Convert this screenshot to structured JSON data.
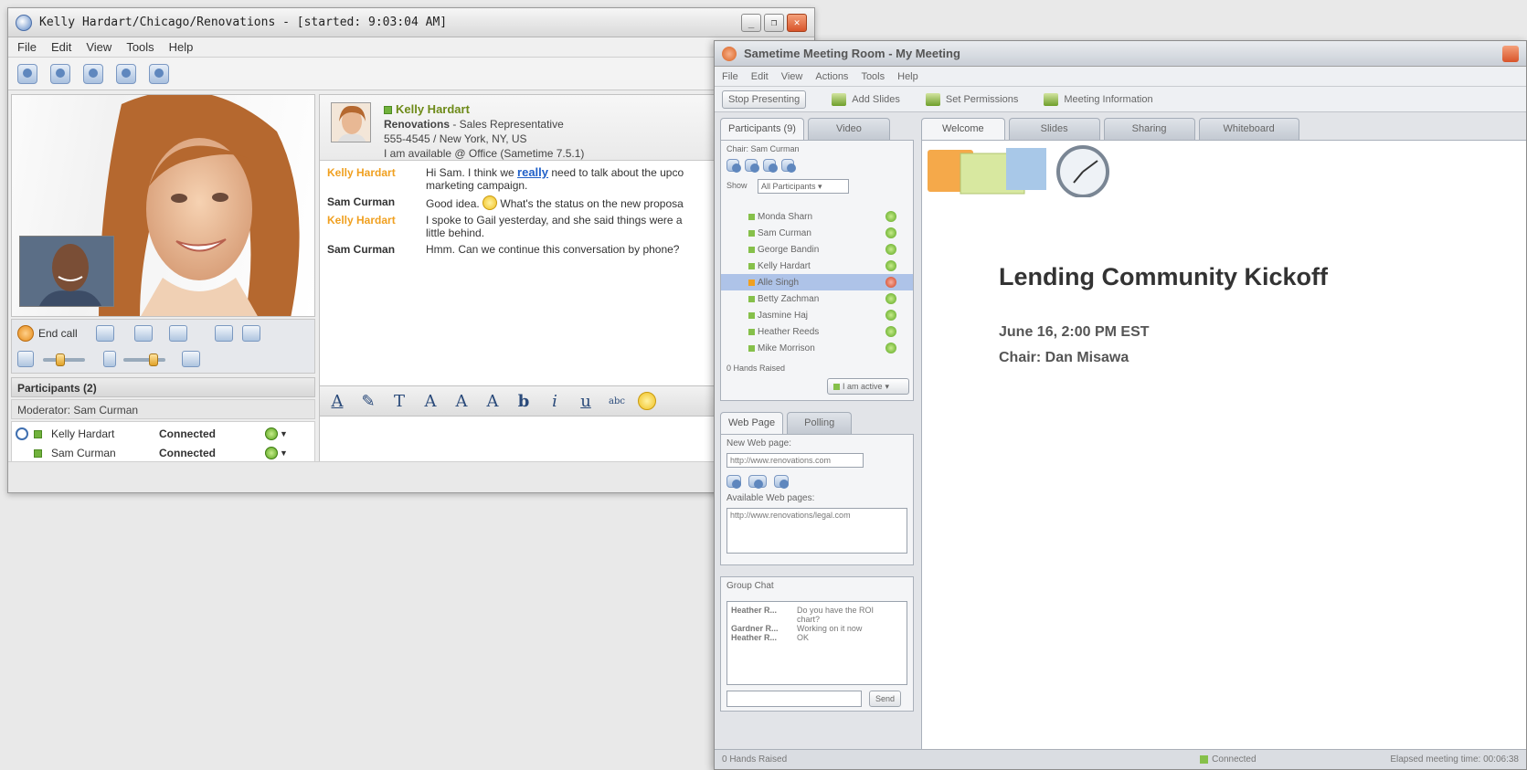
{
  "chat_window": {
    "title": "Kelly Hardart/Chicago/Renovations - [started: 9:03:04 AM]",
    "menu": [
      "File",
      "Edit",
      "View",
      "Tools",
      "Help"
    ],
    "end_call_label": "End call",
    "participants_header": "Participants (2)",
    "moderator": "Moderator: Sam Curman",
    "participants": [
      {
        "name": "Kelly Hardart",
        "status": "Connected"
      },
      {
        "name": "Sam Curman",
        "status": "Connected"
      }
    ],
    "contact": {
      "name": "Kelly Hardart",
      "company": "Renovations",
      "role": " - Sales Representative",
      "phone_location": "555-4545 / New York, NY, US",
      "availability": "I am available @ Office (Sametime 7.5.1)"
    },
    "messages": [
      {
        "sender": "Kelly Hardart",
        "pre": "Hi Sam. I think we ",
        "link": "really",
        "post": " need to talk about the upco marketing campaign."
      },
      {
        "sender": "Sam Curman",
        "pre": "Good idea. ",
        "post": " What's the status on the new proposa"
      },
      {
        "sender": "Kelly Hardart",
        "text": "I spoke to Gail yesterday, and she said things were a little behind."
      },
      {
        "sender": "Sam Curman",
        "text": "Hmm. Can we continue this conversation by phone?"
      }
    ],
    "format_glyphs": [
      "A",
      "✎",
      "T",
      "A",
      "A",
      "A",
      "b",
      "i",
      "u",
      "abc"
    ]
  },
  "meeting_window": {
    "title": "Sametime Meeting Room - My Meeting",
    "menu": [
      "File",
      "Edit",
      "View",
      "Actions",
      "Tools",
      "Help"
    ],
    "toolbar": {
      "stop_presenting": "Stop Presenting",
      "add_slides": "Add Slides",
      "set_permissions": "Set Permissions",
      "meeting_info": "Meeting Information"
    },
    "left_tabs": [
      "Participants (9)",
      "Video"
    ],
    "chair": "Chair: Sam Curman",
    "show_label": "Show",
    "show_select": "All Participants",
    "participants": [
      {
        "name": "Monda Sharn",
        "selected": false,
        "status": "green"
      },
      {
        "name": "Sam Curman",
        "selected": false,
        "status": "green"
      },
      {
        "name": "George Bandin",
        "selected": false,
        "status": "green"
      },
      {
        "name": "Kelly Hardart",
        "selected": false,
        "status": "green"
      },
      {
        "name": "Alle Singh",
        "selected": true,
        "status": "red"
      },
      {
        "name": "Betty Zachman",
        "selected": false,
        "status": "green"
      },
      {
        "name": "Jasmine Haj",
        "selected": false,
        "status": "green"
      },
      {
        "name": "Heather Reeds",
        "selected": false,
        "status": "green"
      },
      {
        "name": "Mike Morrison",
        "selected": false,
        "status": "green"
      }
    ],
    "hands_raised": "0 Hands Raised",
    "active_button": "I am active",
    "web_tabs": [
      "Web Page",
      "Polling"
    ],
    "new_web_page_label": "New Web page:",
    "new_web_page_value": "http://www.renovations.com",
    "available_pages_label": "Available Web pages:",
    "available_page": "http://www.renovations/legal.com",
    "group_chat_label": "Group Chat",
    "group_chat": [
      {
        "who": "Heather R...",
        "text": "Do you have the ROI chart?"
      },
      {
        "who": "Gardner R...",
        "text": "Working on it now"
      },
      {
        "who": "Heather R...",
        "text": "OK"
      }
    ],
    "send_label": "Send",
    "main_tabs": [
      "Welcome",
      "Slides",
      "Sharing",
      "Whiteboard"
    ],
    "slide": {
      "title": "Lending Community Kickoff",
      "date": "June 16, 2:00 PM EST",
      "chair": "Chair: Dan Misawa"
    },
    "status_left": "0 Hands Raised",
    "status_mid": "Connected",
    "status_right": "Elapsed meeting time: 00:06:38"
  }
}
